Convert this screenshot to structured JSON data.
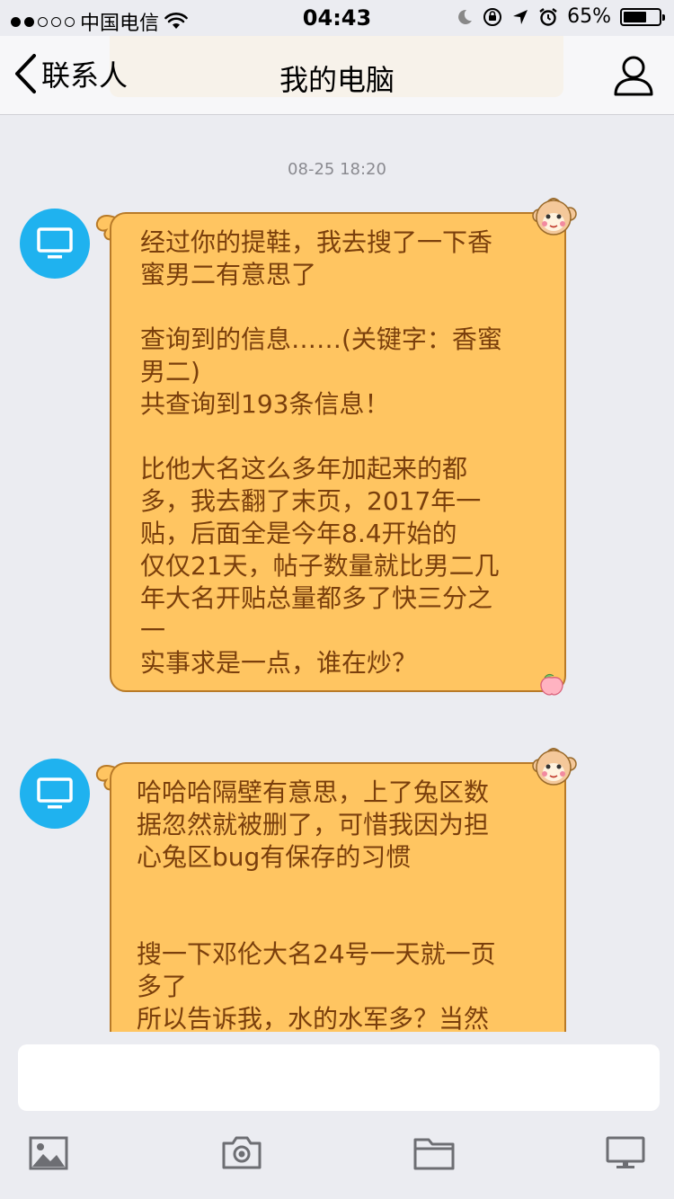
{
  "status_bar": {
    "carrier": "中国电信",
    "time": "04:43",
    "battery_percent": "65%",
    "battery_level": 0.65,
    "signal_dots_filled": 2,
    "signal_dots_total": 5
  },
  "nav": {
    "back_label": "联系人",
    "title": "我的电脑"
  },
  "chat": {
    "timestamp": "08-25 18:20",
    "messages": [
      {
        "lines": [
          "经过你的提鞋，我去搜了一下香",
          "蜜男二有意思了",
          "",
          "查询到的信息……(关键字：香蜜",
          "男二)",
          "共查询到193条信息！",
          "",
          "比他大名这么多年加起来的都",
          "多，我去翻了末页，2017年一",
          "贴，后面全是今年8.4开始的",
          "仅仅21天，帖子数量就比男二几",
          "年大名开贴总量都多了快三分之",
          "一",
          "实事求是一点，谁在炒？"
        ]
      },
      {
        "lines": [
          "哈哈哈隔壁有意思，上了兔区数",
          "据忽然就被删了，可惜我因为担",
          "心兔区bug有保存的习惯",
          "",
          "",
          "搜一下邓伦大名24号一天就一页",
          "多了",
          "所以告诉我，水的水军多？当然"
        ]
      }
    ]
  },
  "colors": {
    "bubble_fill": "#ffc561",
    "bubble_border": "#b87a28",
    "bubble_text": "#7a3f0c",
    "avatar": "#1fb2ef",
    "background": "#ebecf1"
  },
  "icons": {
    "avatar": "computer-monitor-icon",
    "toolbar": [
      "image-icon",
      "camera-icon",
      "folder-icon",
      "computer-monitor-icon"
    ]
  }
}
